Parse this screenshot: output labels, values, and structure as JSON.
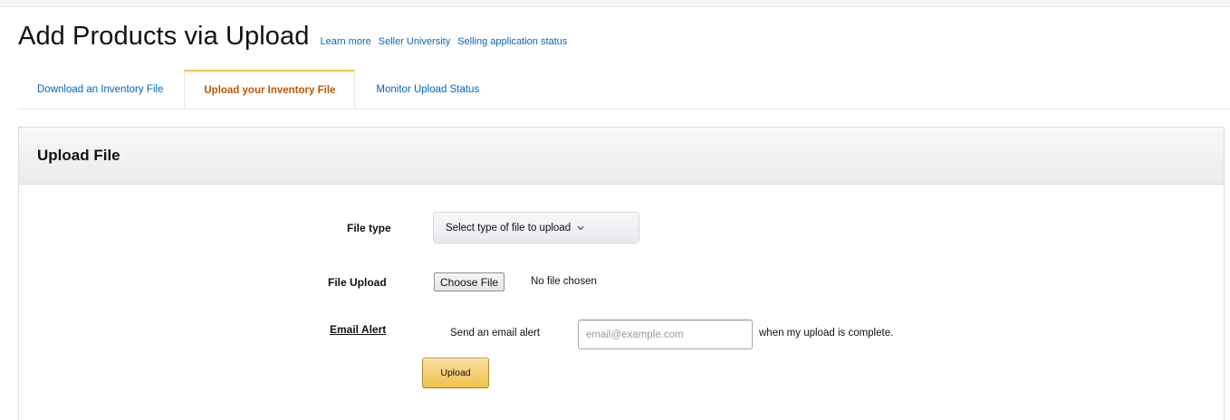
{
  "header": {
    "title": "Add Products via Upload",
    "links": [
      "Learn more",
      "Seller University",
      "Selling application status"
    ]
  },
  "tabs": [
    {
      "label": "Download an Inventory File",
      "active": false
    },
    {
      "label": "Upload your Inventory File",
      "active": true
    },
    {
      "label": "Monitor Upload Status",
      "active": false
    }
  ],
  "panel": {
    "title": "Upload File",
    "file_type": {
      "label": "File type",
      "selected": "Select type of file to upload"
    },
    "file_upload": {
      "label": "File Upload",
      "button": "Choose File",
      "status": "No file chosen"
    },
    "email_alert": {
      "label": "Email Alert",
      "prefix": "Send an email alert",
      "placeholder": "email@example.com",
      "value": "",
      "suffix": "when my upload is complete."
    },
    "upload_button": "Upload"
  },
  "colors": {
    "link": "#0066c0",
    "active_tab": "#c45500",
    "button_yellow": "#f0c14b"
  },
  "icons": {
    "select_chevron": "chevron-down-icon"
  }
}
